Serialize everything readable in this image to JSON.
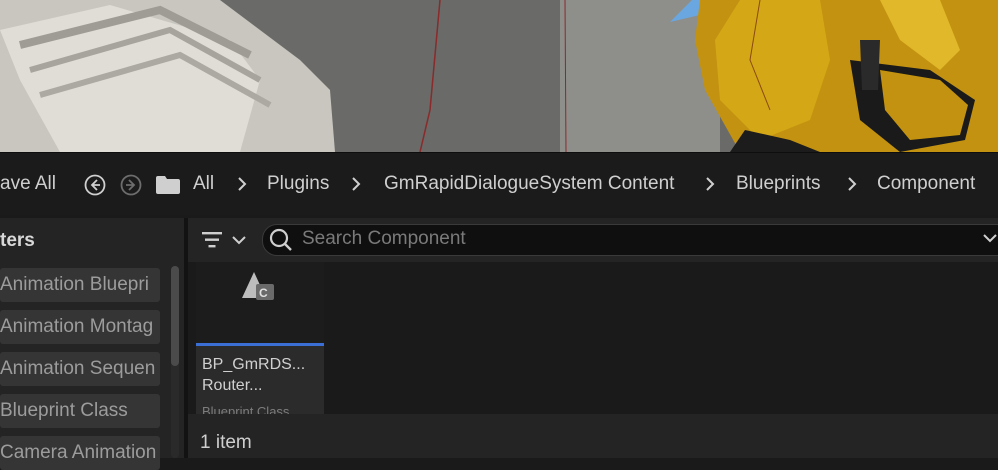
{
  "toolbar": {
    "save_all_label": "ave All",
    "breadcrumb": [
      "All",
      "Plugins",
      "GmRapidDialogueSystem Content",
      "Blueprints",
      "Component"
    ]
  },
  "filters": {
    "title": "ters",
    "items": [
      "Animation Bluepri",
      "Animation Montag",
      "Animation Sequen",
      "Blueprint Class",
      "Camera Animation"
    ]
  },
  "search": {
    "placeholder": "Search Component",
    "value": ""
  },
  "assets": [
    {
      "name": "BP_GmRDS... Router...",
      "type": "Blueprint Class"
    }
  ],
  "status": {
    "item_count": "1 item"
  },
  "colors": {
    "accent": "#3b6fd6",
    "character_yellow": "#c99a12"
  }
}
